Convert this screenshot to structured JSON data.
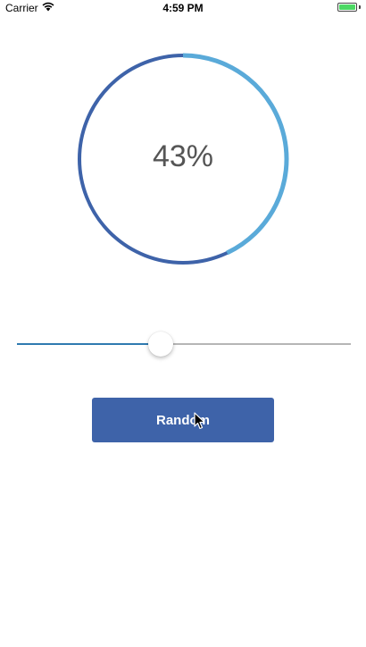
{
  "status_bar": {
    "carrier": "Carrier",
    "time": "4:59 PM",
    "wifi_icon": "wifi-icon",
    "battery_icon": "battery-icon",
    "battery_color": "#4cd964"
  },
  "progress": {
    "value": 0.43,
    "label": "43%",
    "ring_color": "#3e63a9",
    "progress_color": "#5aaad9"
  },
  "slider": {
    "value": 0.43,
    "min_track_color": "#2f7ab0",
    "max_track_color": "#b6b6b6"
  },
  "button": {
    "label": "Random",
    "color": "#3e63a9"
  },
  "cursor_icon": "arrow-cursor-icon"
}
